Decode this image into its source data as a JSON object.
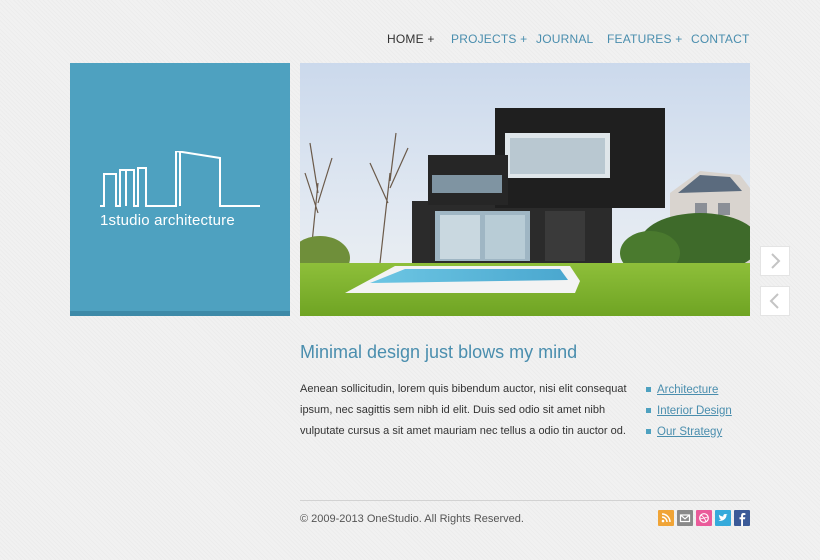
{
  "nav": {
    "items": [
      {
        "label": "HOME +"
      },
      {
        "label": "PROJECTS +"
      },
      {
        "label": "JOURNAL"
      },
      {
        "label": "FEATURES +"
      },
      {
        "label": "CONTACT"
      }
    ]
  },
  "logo": {
    "text": "1studio architecture"
  },
  "content": {
    "heading": "Minimal design just blows my mind",
    "paragraph": "Aenean sollicitudin, lorem quis bibendum auctor, nisi elit consequat ipsum, nec sagittis sem nibh id elit. Duis sed odio sit amet nibh vulputate cursus a sit amet mauriam nec tellus a odio tin auctor od."
  },
  "links": [
    {
      "label": "Architecture"
    },
    {
      "label": "Interior Design"
    },
    {
      "label": "Our Strategy"
    }
  ],
  "footer": {
    "copyright": "© 2009-2013 OneStudio. All Rights Reserved."
  },
  "social": [
    {
      "icon": "rss-icon",
      "color": "#f0a436"
    },
    {
      "icon": "email-icon",
      "color": "#8a8a8a"
    },
    {
      "icon": "dribbble-icon",
      "color": "#ea5b9a"
    },
    {
      "icon": "twitter-icon",
      "color": "#35aadb"
    },
    {
      "icon": "facebook-icon",
      "color": "#3b5a98"
    }
  ],
  "colors": {
    "accent": "#4ea1c0",
    "link": "#4a8eae"
  }
}
